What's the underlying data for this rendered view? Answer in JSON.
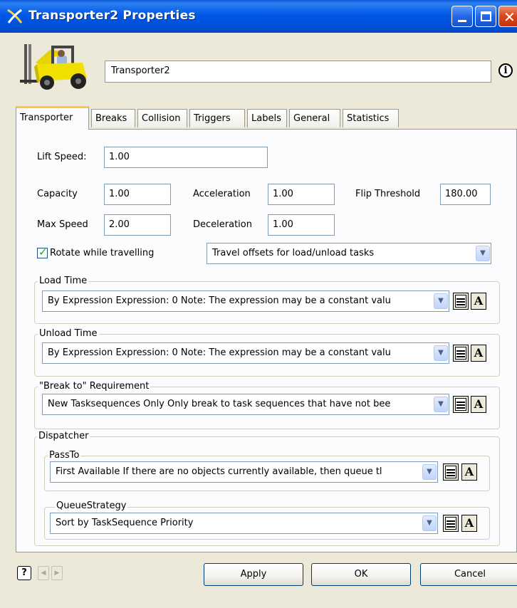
{
  "window": {
    "title": "Transporter2 Properties",
    "app_icon": "flexsim-x-icon"
  },
  "header": {
    "object_name": "Transporter2",
    "object_icon": "forklift-icon",
    "info_icon": "info-icon"
  },
  "tabs": [
    {
      "label": "Transporter",
      "active": true
    },
    {
      "label": "Breaks",
      "active": false
    },
    {
      "label": "Collision",
      "active": false
    },
    {
      "label": "Triggers",
      "active": false
    },
    {
      "label": "Labels",
      "active": false
    },
    {
      "label": "General",
      "active": false
    },
    {
      "label": "Statistics",
      "active": false
    }
  ],
  "transporter": {
    "lift_speed_label": "Lift Speed:",
    "lift_speed": "1.00",
    "capacity_label": "Capacity",
    "capacity": "1.00",
    "acceleration_label": "Acceleration",
    "acceleration": "1.00",
    "flip_threshold_label": "Flip Threshold",
    "flip_threshold": "180.00",
    "max_speed_label": "Max Speed",
    "max_speed": "2.00",
    "deceleration_label": "Deceleration",
    "deceleration": "1.00",
    "rotate_label": "Rotate while travelling",
    "rotate_checked": true,
    "travel_offsets": "Travel offsets for load/unload tasks"
  },
  "load_time": {
    "title": "Load Time",
    "value": "By Expression Expression: 0 Note: The expression may be a constant valu"
  },
  "unload_time": {
    "title": "Unload Time",
    "value": "By Expression Expression: 0 Note: The expression may be a constant valu"
  },
  "break_to": {
    "title": "\"Break to\" Requirement",
    "value": "New Tasksequences Only Only break to task sequences that have not bee"
  },
  "dispatcher": {
    "title": "Dispatcher",
    "pass_to_title": "PassTo",
    "pass_to_value": "First Available If there are no objects currently available, then queue tl",
    "queue_strategy_title": "QueueStrategy",
    "queue_strategy_value": "Sort by TaskSequence Priority"
  },
  "footer": {
    "help_icon": "help-icon",
    "apply_label": "Apply",
    "ok_label": "OK",
    "cancel_label": "Cancel"
  }
}
